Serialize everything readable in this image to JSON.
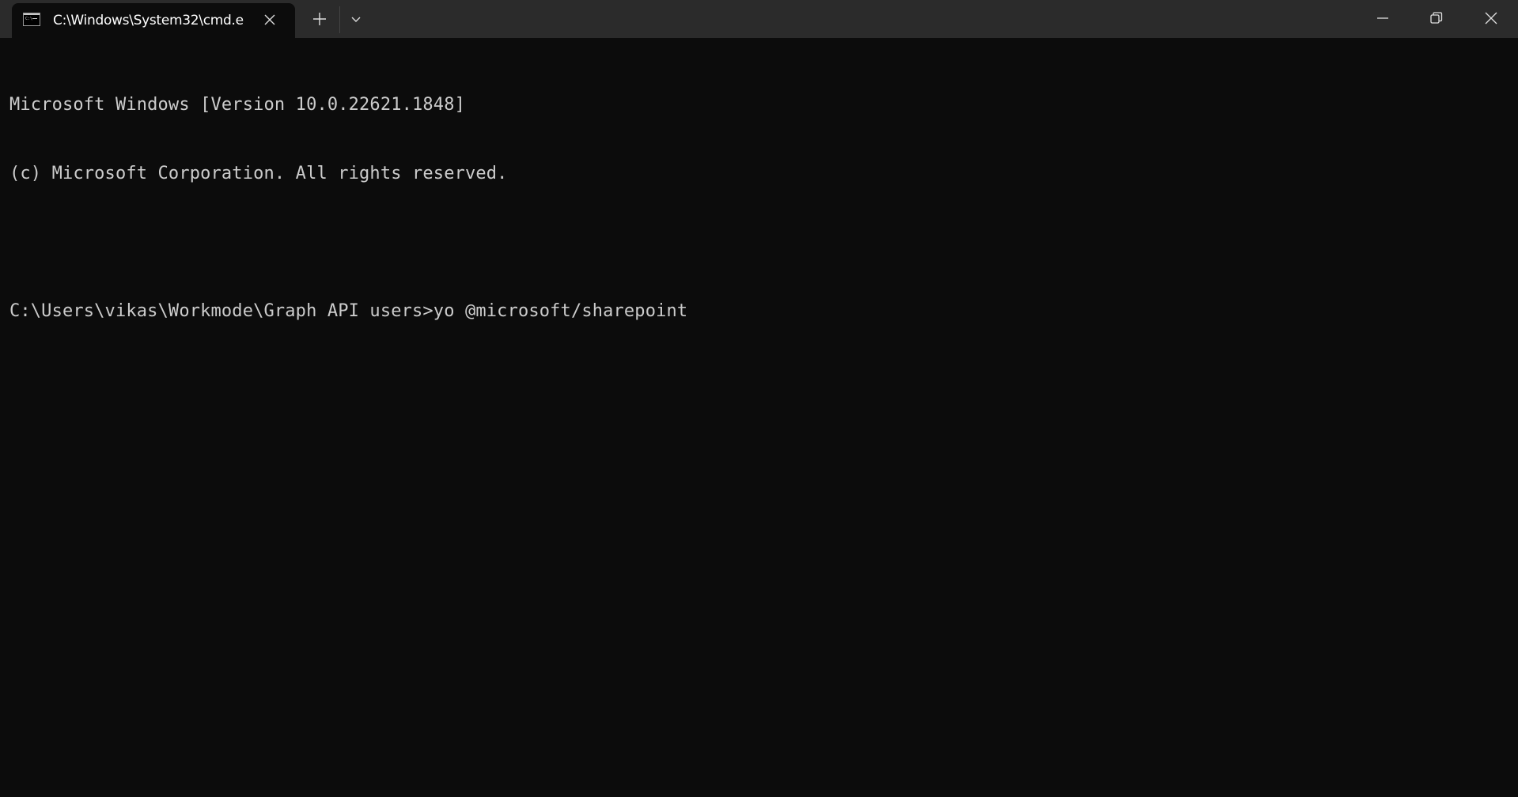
{
  "tab": {
    "icon": "terminal-icon",
    "title": "C:\\Windows\\System32\\cmd.e"
  },
  "titlebar": {
    "new_tab_icon": "plus-icon",
    "dropdown_icon": "chevron-down-icon",
    "minimize_icon": "minimize-icon",
    "maximize_icon": "restore-icon",
    "close_icon": "close-icon"
  },
  "console": {
    "lines": [
      "Microsoft Windows [Version 10.0.22621.1848]",
      "(c) Microsoft Corporation. All rights reserved.",
      "",
      "C:\\Users\\vikas\\Workmode\\Graph API users>yo @microsoft/sharepoint"
    ]
  }
}
